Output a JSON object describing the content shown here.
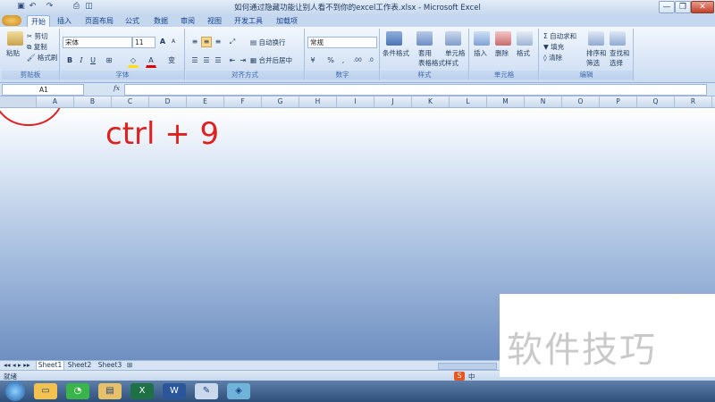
{
  "window": {
    "title": "如何通过隐藏功能让别人看不到你的excel工作表.xlsx - Microsoft Excel",
    "minimize": "—",
    "maximize": "❐",
    "close": "✕"
  },
  "quick_access": [
    "save-icon",
    "undo-icon",
    "redo-icon",
    "print-icon",
    "preview-icon"
  ],
  "tabs": [
    {
      "label": "开始",
      "active": true
    },
    {
      "label": "插入"
    },
    {
      "label": "页面布局"
    },
    {
      "label": "公式"
    },
    {
      "label": "数据"
    },
    {
      "label": "审阅"
    },
    {
      "label": "视图"
    },
    {
      "label": "开发工具"
    },
    {
      "label": "加载项"
    }
  ],
  "ribbon": {
    "clipboard": {
      "label": "剪贴板",
      "paste": "粘贴",
      "cut": "剪切",
      "copy": "复制",
      "format_painter": "格式刷"
    },
    "font": {
      "label": "字体",
      "font_name": "宋体",
      "font_size": "11",
      "bold": "B",
      "italic": "I",
      "underline": "U",
      "grow": "A",
      "shrink": "A",
      "font_color": "A",
      "phonetic": "变"
    },
    "alignment": {
      "label": "对齐方式",
      "wrap": "自动换行",
      "merge": "合并后居中"
    },
    "number": {
      "label": "数字",
      "format": "常规",
      "percent": "%",
      "comma": ",",
      "increase": ".00",
      "decrease": ".0"
    },
    "styles": {
      "label": "样式",
      "conditional": "条件格式",
      "table_format_1": "套用",
      "table_format_2": "表格格式",
      "cell_style_1": "单元格",
      "cell_style_2": "样式"
    },
    "cells": {
      "label": "单元格",
      "insert": "插入",
      "delete": "删除",
      "format": "格式"
    },
    "editing": {
      "label": "编辑",
      "autosum": "自动求和",
      "fill": "填充",
      "clear": "清除",
      "sort_1": "排序和",
      "sort_2": "筛选",
      "find_1": "查找和",
      "find_2": "选择"
    }
  },
  "formula_bar": {
    "name_box": "A1",
    "fx": "fx",
    "value": ""
  },
  "columns": [
    "A",
    "B",
    "C",
    "D",
    "E",
    "F",
    "G",
    "H",
    "I",
    "J",
    "K",
    "L",
    "M",
    "N",
    "O",
    "P",
    "Q",
    "R"
  ],
  "annotation": {
    "text": "ctrl + 9",
    "color": "#e02020"
  },
  "sheets": [
    "Sheet1",
    "Sheet2",
    "Sheet3"
  ],
  "status": {
    "ready": "就绪",
    "ime": "中"
  },
  "taskbar": [
    "start",
    "folder-icon",
    "wechat-icon",
    "explorer-icon",
    "excel-icon",
    "word-icon",
    "paint-icon",
    "app-icon"
  ],
  "watermark": "软件技巧"
}
